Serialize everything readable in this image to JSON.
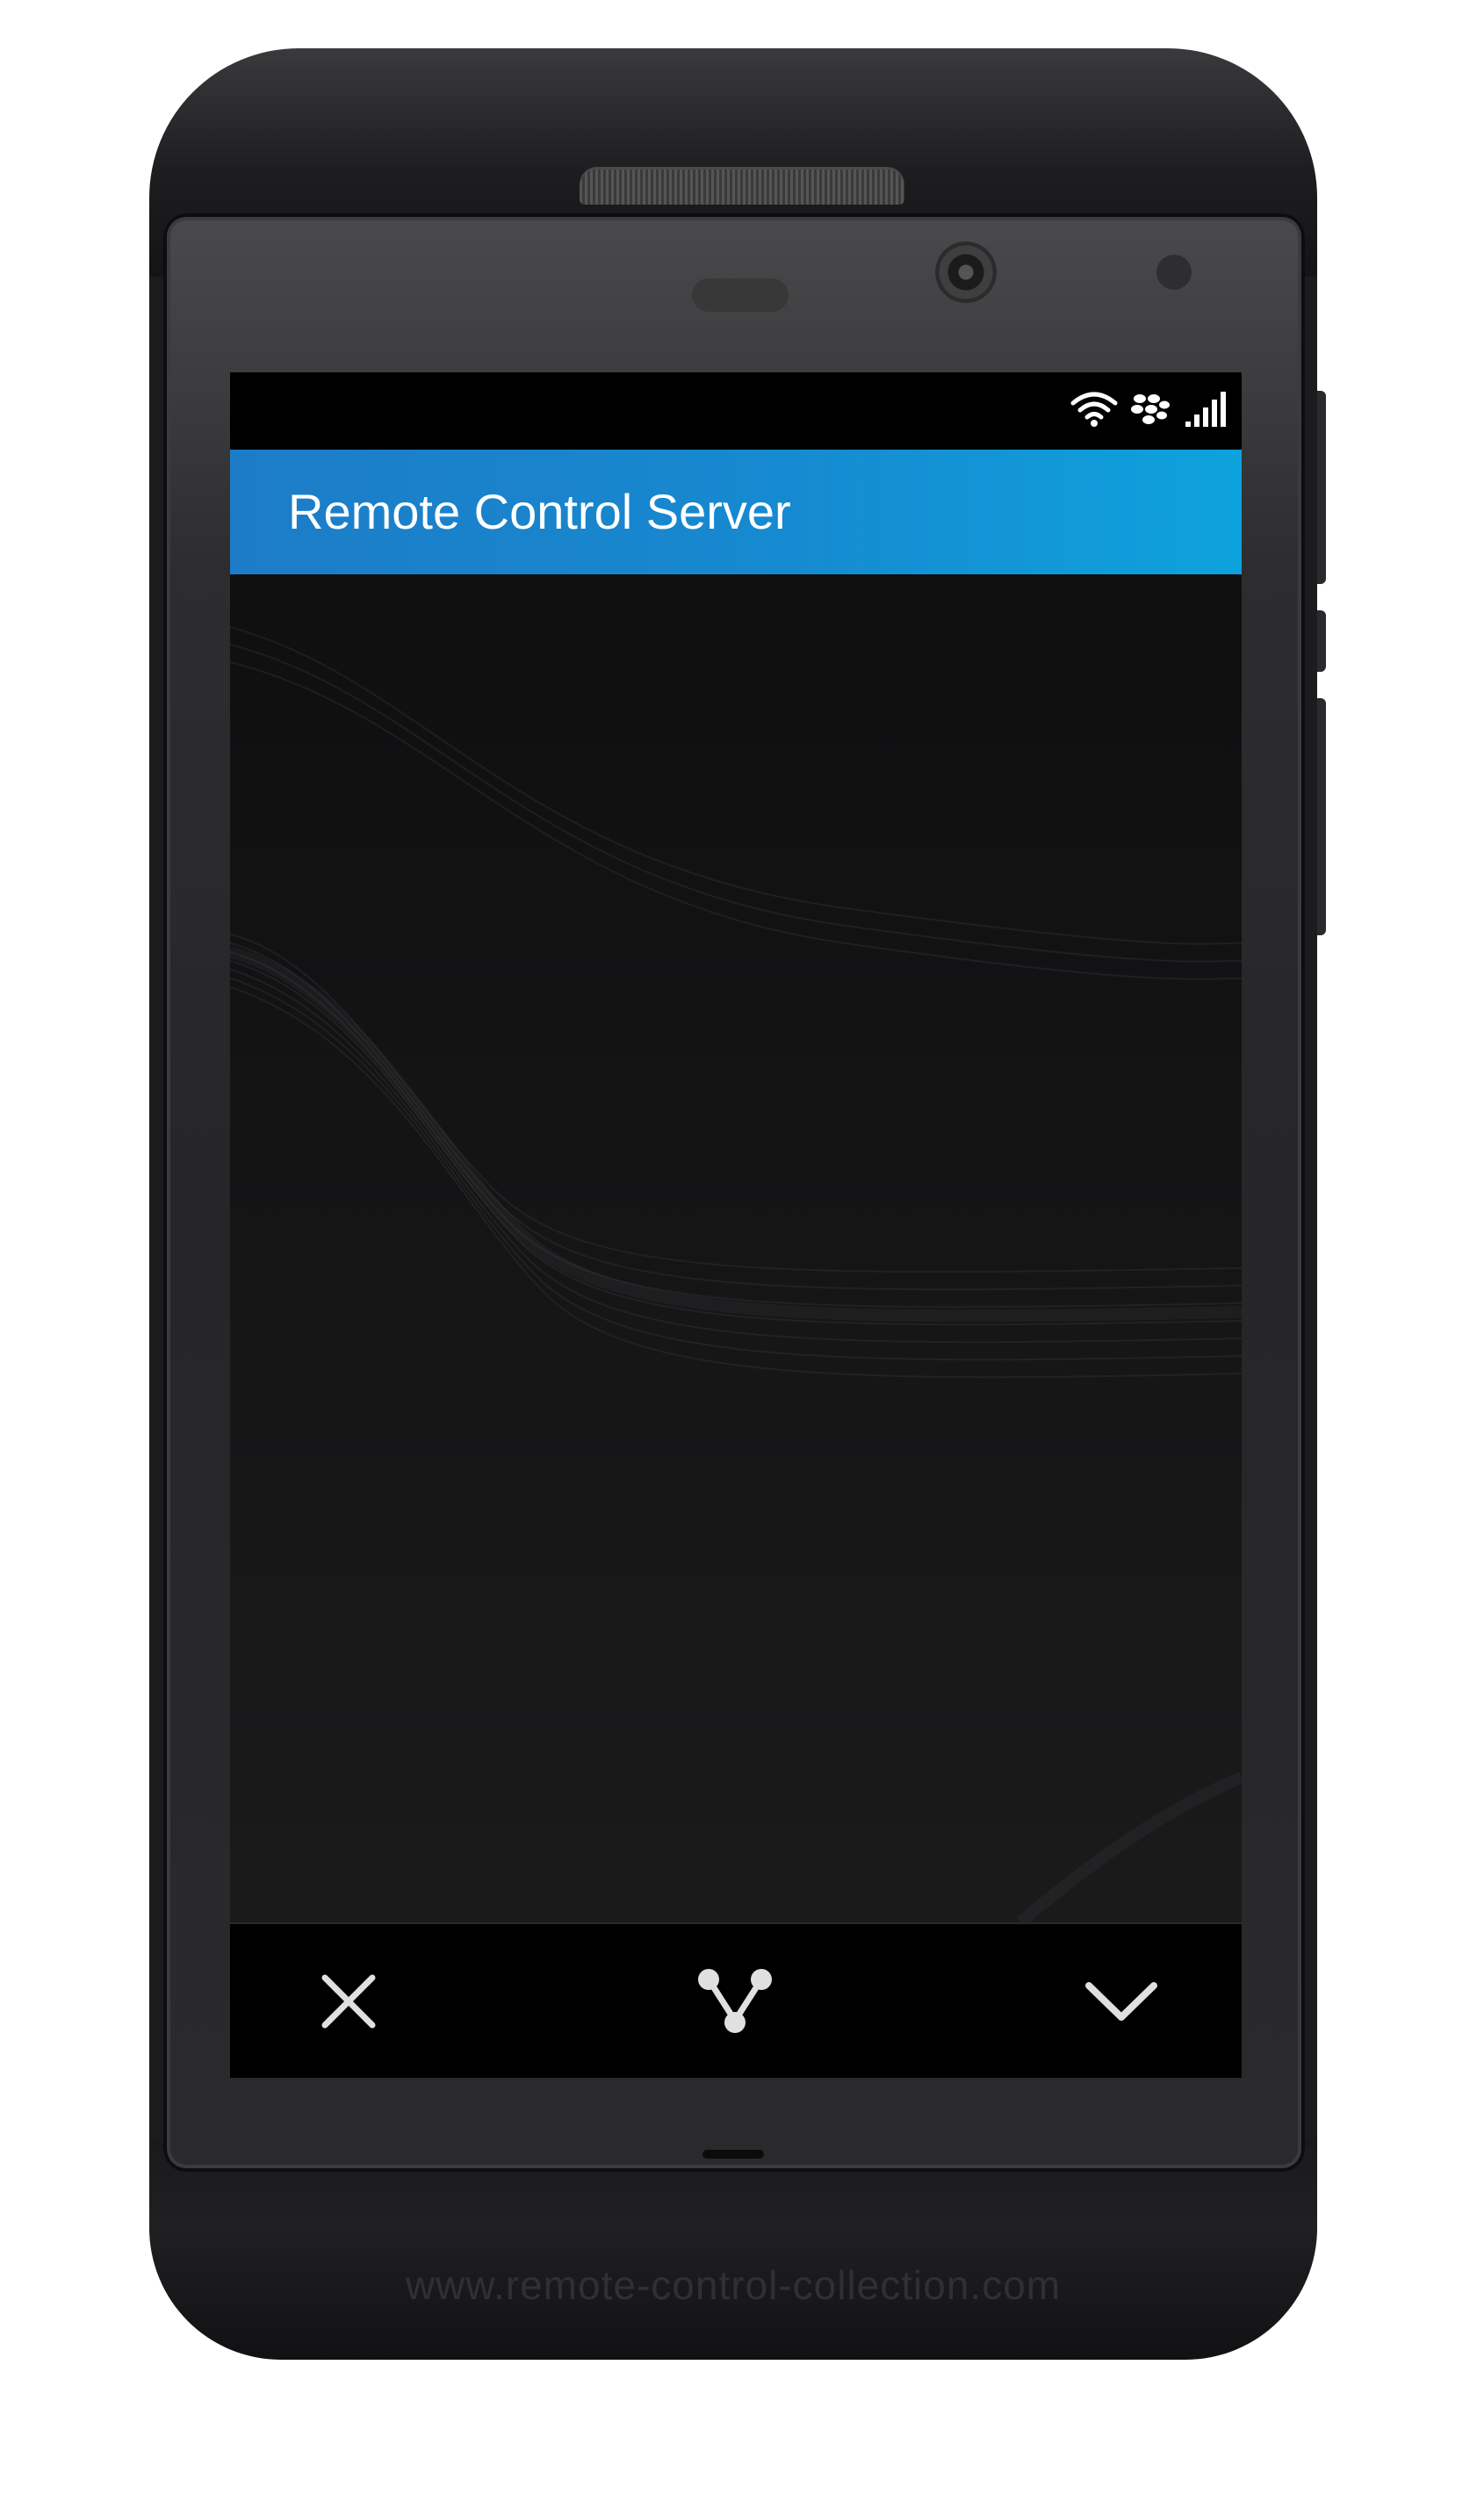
{
  "app": {
    "title": "Remote Control Server"
  },
  "status_bar": {
    "icons": [
      "wifi-icon",
      "blackberry-logo-icon",
      "signal-strength-icon"
    ]
  },
  "action_bar": {
    "buttons": [
      {
        "name": "close-button",
        "icon": "close-icon"
      },
      {
        "name": "share-button",
        "icon": "share-icon"
      },
      {
        "name": "confirm-button",
        "icon": "checkmark-icon"
      }
    ]
  },
  "watermark": {
    "text": "www.remote-control-collection.com"
  },
  "colors": {
    "app_bar_start": "#1d7cc7",
    "app_bar_end": "#0ea2dd",
    "screen_background": "#121213",
    "icon": "#e0e0e0"
  }
}
